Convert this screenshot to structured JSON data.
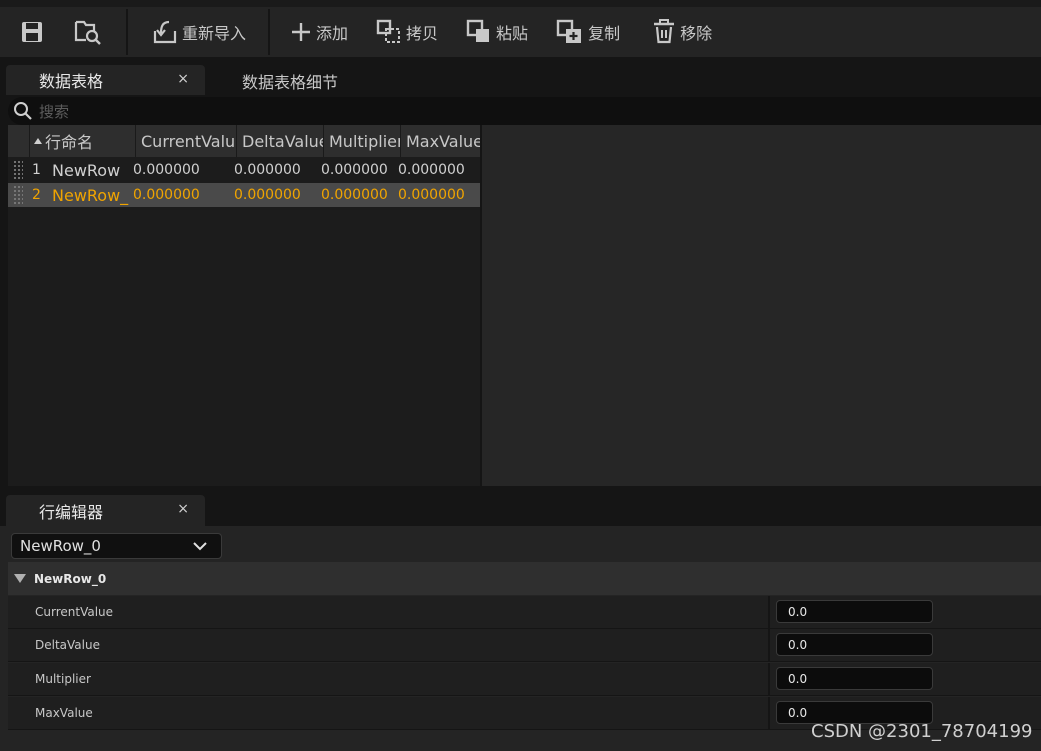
{
  "toolbar": {
    "save_icon": "save-icon",
    "browse_icon": "browse-search-icon",
    "reimport_label": "重新导入",
    "add_label": "添加",
    "copy_label": "拷贝",
    "paste_label": "粘贴",
    "duplicate_label": "复制",
    "remove_label": "移除"
  },
  "tabs_top": {
    "active_label": "数据表格",
    "inactive_label": "数据表格细节",
    "close_glyph": "×"
  },
  "search": {
    "placeholder": "搜索"
  },
  "table": {
    "columns": [
      "行命名",
      "CurrentValue",
      "DeltaValue",
      "Multiplier",
      "MaxValue"
    ],
    "rows": [
      {
        "index": "1",
        "name": "NewRow",
        "values": [
          "0.000000",
          "0.000000",
          "0.000000",
          "0.000000"
        ],
        "selected": false
      },
      {
        "index": "2",
        "name": "NewRow_",
        "values": [
          "0.000000",
          "0.000000",
          "0.000000",
          "0.000000"
        ],
        "selected": true
      }
    ]
  },
  "row_editor": {
    "tab_label": "行编辑器",
    "close_glyph": "×",
    "selected_row": "NewRow_0",
    "category_label": "NewRow_0",
    "properties": [
      {
        "name": "CurrentValue",
        "value": "0.0"
      },
      {
        "name": "DeltaValue",
        "value": "0.0"
      },
      {
        "name": "Multiplier",
        "value": "0.0"
      },
      {
        "name": "MaxValue",
        "value": "0.0"
      }
    ]
  },
  "watermark": "CSDN @2301_78704199",
  "colors": {
    "accent_selected": "#f0a400",
    "background": "#151515",
    "panel": "#242424"
  }
}
